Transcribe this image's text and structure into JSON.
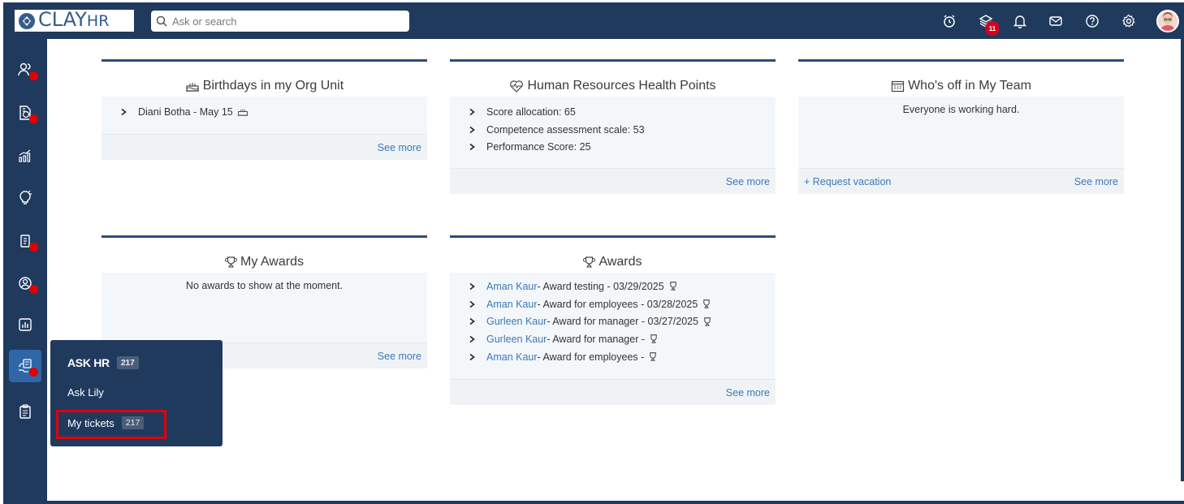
{
  "app": {
    "logo_main": "CLAY",
    "logo_sub": "HR",
    "search_placeholder": "Ask or search",
    "layers_badge": "11"
  },
  "colors": {
    "nav_bg": "#203a5e",
    "accent_active": "#2e66a8",
    "link": "#3d78b8",
    "notification_dot": "#e10000",
    "highlight_box": "#e0000b"
  },
  "cards": {
    "birthdays": {
      "title": "Birthdays in my Org Unit",
      "items": [
        "Diani Botha - May 15"
      ],
      "see_more": "See more"
    },
    "health": {
      "title": "Human Resources Health Points",
      "items": [
        "Score allocation: 65",
        "Competence assessment scale: 53",
        "Performance Score: 25"
      ],
      "see_more": "See more"
    },
    "whos_off": {
      "title": "Who's off in My Team",
      "message": "Everyone is working hard.",
      "request_vacation": "+ Request vacation",
      "see_more": "See more"
    },
    "my_awards": {
      "title": "My Awards",
      "message": "No awards to show at the moment.",
      "see_more": "See more"
    },
    "awards": {
      "title": "Awards",
      "items": [
        {
          "name": "Aman Kaur",
          "text": " - Award testing - 03/29/2025"
        },
        {
          "name": "Aman Kaur",
          "text": " - Award for employees - 03/28/2025"
        },
        {
          "name": "Gurleen Kaur",
          "text": " - Award for manager - 03/27/2025"
        },
        {
          "name": "Gurleen Kaur",
          "text": " - Award for manager -"
        },
        {
          "name": "Aman Kaur",
          "text": " - Award for employees -"
        }
      ],
      "see_more": "See more"
    }
  },
  "popup": {
    "title": "ASK HR",
    "title_count": "217",
    "ask_lily": "Ask Lily",
    "my_tickets": "My tickets",
    "my_tickets_count": "217"
  }
}
